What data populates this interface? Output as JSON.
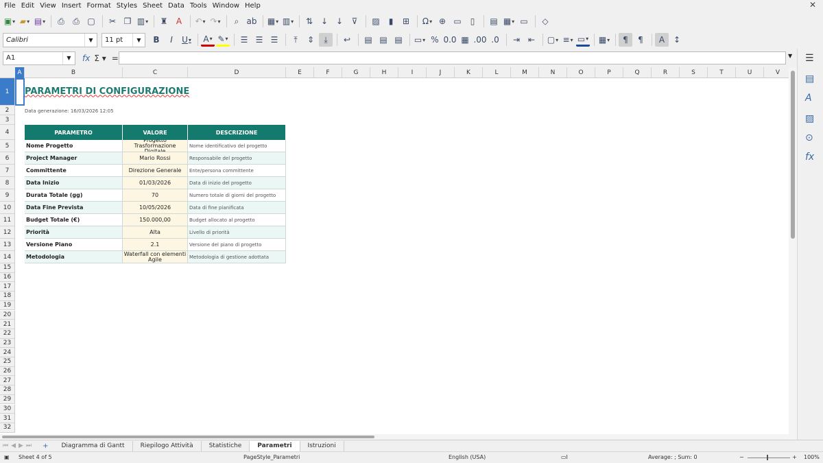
{
  "menu": [
    "File",
    "Edit",
    "View",
    "Insert",
    "Format",
    "Styles",
    "Sheet",
    "Data",
    "Tools",
    "Window",
    "Help"
  ],
  "font_name": "Calibri",
  "font_size": "11 pt",
  "name_box": "A1",
  "columns": [
    "A",
    "B",
    "C",
    "D",
    "E",
    "F",
    "G",
    "H",
    "I",
    "J",
    "K",
    "L",
    "M",
    "N",
    "O",
    "P",
    "Q",
    "R",
    "S",
    "T",
    "U",
    "V"
  ],
  "rows": [
    "1",
    "2",
    "3",
    "4",
    "5",
    "6",
    "7",
    "8",
    "9",
    "10",
    "11",
    "12",
    "13",
    "14",
    "15",
    "16",
    "17",
    "18",
    "19",
    "20",
    "21",
    "22",
    "23",
    "24",
    "25",
    "26",
    "27",
    "28",
    "29",
    "30",
    "31",
    "32"
  ],
  "sheet": {
    "title": "PARAMETRI DI CONFIGURAZIONE",
    "generated": "Data generazione: 16/03/2026 12:05",
    "headers": [
      "PARAMETRO",
      "VALORE",
      "DESCRIZIONE"
    ],
    "data": [
      [
        "Nome Progetto",
        "Progetto Trasformazione Digitale",
        "Nome identificativo del progetto"
      ],
      [
        "Project Manager",
        "Mario Rossi",
        "Responsabile del progetto"
      ],
      [
        "Committente",
        "Direzione Generale",
        "Ente/persona committente"
      ],
      [
        "Data Inizio",
        "01/03/2026",
        "Data di inizio del progetto"
      ],
      [
        "Durata Totale (gg)",
        "70",
        "Numero totale di giorni del progetto"
      ],
      [
        "Data Fine Prevista",
        "10/05/2026",
        "Data di fine pianificata"
      ],
      [
        "Budget Totale (€)",
        "150.000,00",
        "Budget allocato al progetto"
      ],
      [
        "Priorità",
        "Alta",
        "Livello di priorità"
      ],
      [
        "Versione Piano",
        "2.1",
        "Versione del piano di progetto"
      ],
      [
        "Metodologia",
        "Waterfall con elementi Agile",
        "Metodologia di gestione adottata"
      ]
    ]
  },
  "tabs": [
    "Diagramma di Gantt",
    "Riepilogo Attività",
    "Statistiche",
    "Parametri",
    "Istruzioni"
  ],
  "active_tab": "Parametri",
  "status": {
    "sheet": "Sheet 4 of 5",
    "page_style": "PageStyle_Parametri",
    "language": "English (USA)",
    "summary": "Average: ; Sum: 0",
    "zoom": "100%"
  },
  "colors": {
    "header_bg": "#147a6e",
    "title": "#1e7b72",
    "value_bg": "#fdf6e3",
    "alt_row": "#eaf7f5",
    "selection": "#3a7cc9"
  }
}
